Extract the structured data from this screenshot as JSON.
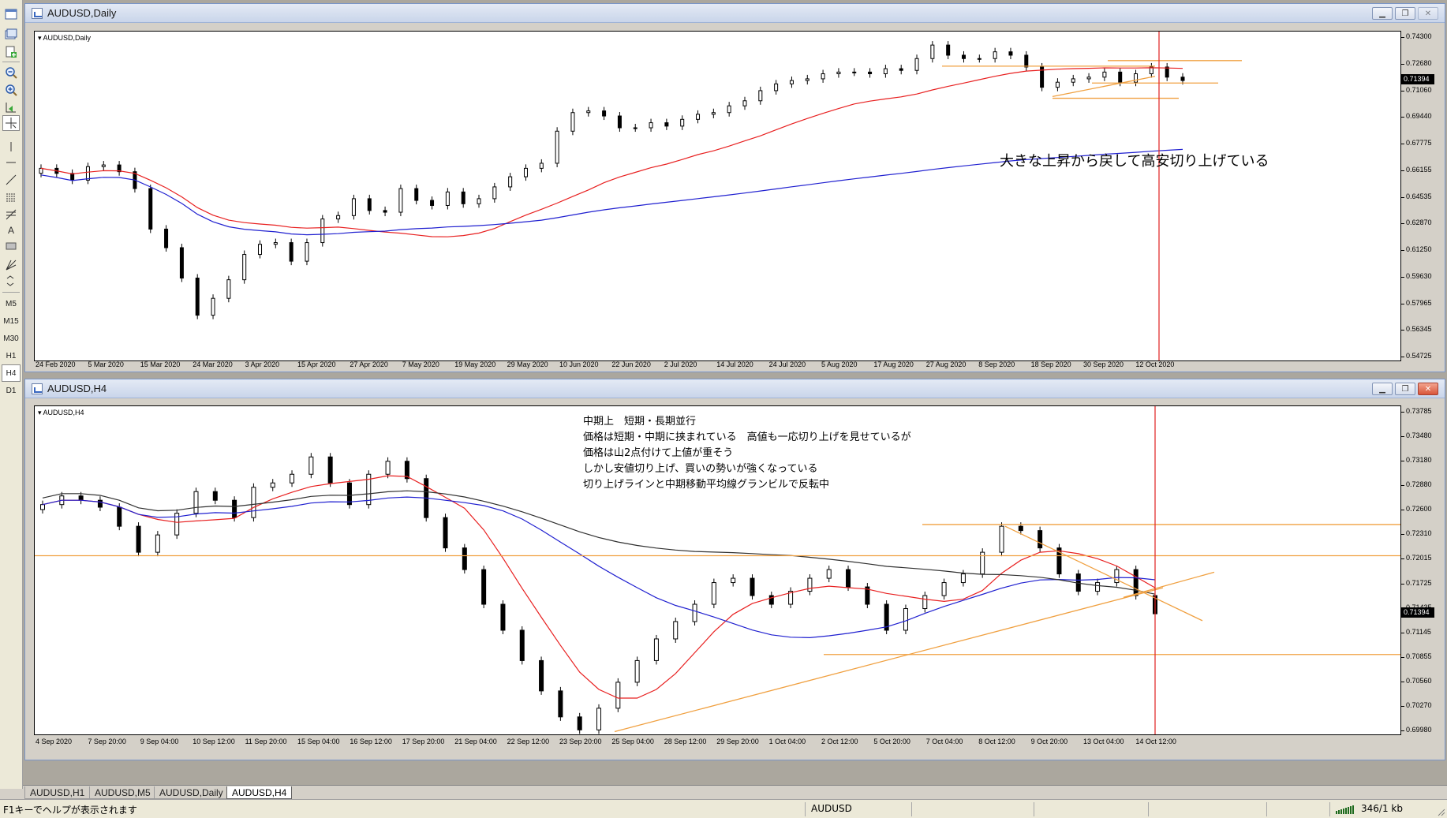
{
  "left_toolbar": {
    "timeframes": [
      "M5",
      "M15",
      "M30",
      "H1",
      "H4",
      "D1"
    ],
    "active_timeframe": "H4"
  },
  "daily": {
    "window_title": "AUDUSD,Daily",
    "symbol_label": "AUDUSD,Daily",
    "current_price": "0.71394",
    "annotation": "大きな上昇から戻して高安切り上げている"
  },
  "h4": {
    "window_title": "AUDUSD,H4",
    "symbol_label": "AUDUSD,H4",
    "current_price": "0.71394",
    "annotation_lines": [
      "中期上　短期・長期並行",
      "価格は短期・中期に挟まれている　高値も一応切り上げを見せているが",
      "価格は山2点付けて上値が重そう",
      "しかし安値切り上げ、買いの勢いが強くなっている",
      "切り上げラインと中期移動平均線グランビルで反転中"
    ]
  },
  "chart_data": [
    {
      "type": "candlestick",
      "title": "AUDUSD,Daily",
      "ylim": [
        0.54725,
        0.743
      ],
      "y_ticks": [
        "0.74300",
        "0.72680",
        "0.71060",
        "0.69440",
        "0.67775",
        "0.66155",
        "0.64535",
        "0.62870",
        "0.61250",
        "0.59630",
        "0.57965",
        "0.56345",
        "0.54725"
      ],
      "x_ticks": [
        "24 Feb 2020",
        "5 Mar 2020",
        "15 Mar 2020",
        "24 Mar 2020",
        "3 Apr 2020",
        "15 Apr 2020",
        "27 Apr 2020",
        "7 May 2020",
        "19 May 2020",
        "29 May 2020",
        "10 Jun 2020",
        "22 Jun 2020",
        "2 Jul 2020",
        "14 Jul 2020",
        "24 Jul 2020",
        "5 Aug 2020",
        "17 Aug 2020",
        "27 Aug 2020",
        "8 Sep 2020",
        "18 Sep 2020",
        "30 Sep 2020",
        "12 Oct 2020"
      ],
      "current_price": 0.71394,
      "series": [
        {
          "type": "close",
          "values": [
            0.662,
            0.659,
            0.655,
            0.663,
            0.664,
            0.66,
            0.65,
            0.626,
            0.615,
            0.597,
            0.575,
            0.585,
            0.596,
            0.611,
            0.617,
            0.618,
            0.607,
            0.618,
            0.632,
            0.634,
            0.644,
            0.637,
            0.636,
            0.65,
            0.643,
            0.64,
            0.648,
            0.641,
            0.644,
            0.651,
            0.657,
            0.662,
            0.665,
            0.684,
            0.695,
            0.696,
            0.693,
            0.686,
            0.686,
            0.689,
            0.687,
            0.691,
            0.694,
            0.695,
            0.699,
            0.702,
            0.708,
            0.712,
            0.714,
            0.715,
            0.718,
            0.719,
            0.719,
            0.718,
            0.721,
            0.72,
            0.727,
            0.735,
            0.729,
            0.727,
            0.727,
            0.731,
            0.729,
            0.722,
            0.71,
            0.713,
            0.715,
            0.716,
            0.719,
            0.713,
            0.718,
            0.722,
            0.716,
            0.714
          ]
        },
        {
          "name": "",
          "type": "ma",
          "color": "#e82020",
          "period": 20
        },
        {
          "name": "",
          "type": "ma",
          "color": "#2020d0",
          "period": 100
        }
      ]
    },
    {
      "type": "candlestick",
      "title": "AUDUSD,H4",
      "ylim": [
        0.6998,
        0.73785
      ],
      "y_ticks": [
        "0.73785",
        "0.73480",
        "0.73180",
        "0.72880",
        "0.72600",
        "0.72310",
        "0.72015",
        "0.71725",
        "0.71435",
        "0.71145",
        "0.70855",
        "0.70560",
        "0.70270",
        "0.69980"
      ],
      "x_ticks": [
        "4 Sep 2020",
        "7 Sep 20:00",
        "9 Sep 04:00",
        "10 Sep 12:00",
        "11 Sep 20:00",
        "15 Sep 04:00",
        "16 Sep 12:00",
        "17 Sep 20:00",
        "21 Sep 04:00",
        "22 Sep 12:00",
        "23 Sep 20:00",
        "25 Sep 04:00",
        "28 Sep 12:00",
        "29 Sep 20:00",
        "1 Oct 04:00",
        "2 Oct 12:00",
        "5 Oct 20:00",
        "7 Oct 04:00",
        "8 Oct 12:00",
        "9 Oct 20:00",
        "13 Oct 04:00",
        "14 Oct 12:00"
      ],
      "current_price": 0.71394,
      "series": [
        {
          "type": "close",
          "values": [
            0.7265,
            0.7275,
            0.727,
            0.7262,
            0.724,
            0.721,
            0.723,
            0.7255,
            0.728,
            0.727,
            0.725,
            0.7285,
            0.729,
            0.73,
            0.732,
            0.729,
            0.7265,
            0.73,
            0.7315,
            0.7295,
            0.725,
            0.7215,
            0.719,
            0.715,
            0.712,
            0.7085,
            0.705,
            0.702,
            0.7005,
            0.703,
            0.706,
            0.7085,
            0.711,
            0.713,
            0.715,
            0.7175,
            0.718,
            0.716,
            0.715,
            0.7165,
            0.718,
            0.719,
            0.717,
            0.715,
            0.712,
            0.7145,
            0.716,
            0.7175,
            0.7185,
            0.721,
            0.724,
            0.7235,
            0.7215,
            0.7185,
            0.7165,
            0.7175,
            0.719,
            0.716,
            0.7139
          ]
        },
        {
          "name": "",
          "type": "ma",
          "color": "#e82020"
        },
        {
          "name": "",
          "type": "ma",
          "color": "#2020d0"
        },
        {
          "name": "",
          "type": "ma",
          "color": "#303030"
        }
      ]
    }
  ],
  "tabs": [
    "AUDUSD,H1",
    "AUDUSD,M5",
    "AUDUSD,Daily",
    "AUDUSD,H4"
  ],
  "active_tab": "AUDUSD,H4",
  "status_bar": {
    "help_text": "F1キーでヘルプが表示されます",
    "symbol": "AUDUSD",
    "traffic": "346/1 kb"
  }
}
